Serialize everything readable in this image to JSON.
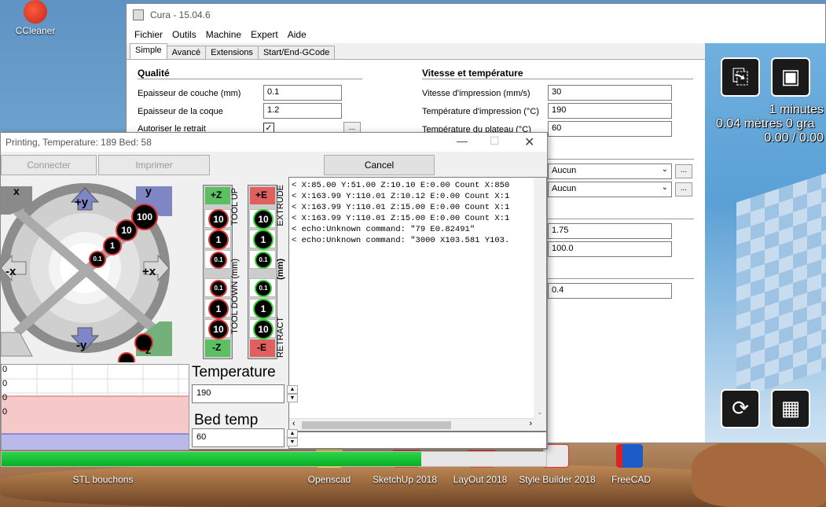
{
  "desktop": {
    "icons": [
      {
        "name": "ccleaner",
        "label": "CCleaner"
      },
      {
        "name": "stl-bouchons",
        "label": "STL bouchons"
      },
      {
        "name": "openscad",
        "label": "Openscad"
      },
      {
        "name": "sketchup",
        "label": "SketchUp 2018"
      },
      {
        "name": "layout",
        "label": "LayOut 2018"
      },
      {
        "name": "style-builder",
        "label": "Style Builder 2018"
      },
      {
        "name": "freecad",
        "label": "FreeCAD"
      }
    ]
  },
  "cura": {
    "title": "Cura - 15.04.6",
    "menu": [
      "Fichier",
      "Outils",
      "Machine",
      "Expert",
      "Aide"
    ],
    "tabs": [
      "Simple",
      "Avancé",
      "Extensions",
      "Start/End-GCode"
    ],
    "quality": {
      "title": "Qualité",
      "layer_height_label": "Epaisseur de couche (mm)",
      "layer_height": "0.1",
      "shell_label": "Epaisseur de la coque",
      "shell": "1.2",
      "retraction_label": "Autoriser le retrait",
      "retraction_checked": "✓",
      "dots": "..."
    },
    "speed": {
      "title": "Vitesse et température",
      "print_speed_label": "Vitesse d'impression (mm/s)",
      "print_speed": "30",
      "print_temp_label": "Température d'impression (°C)",
      "print_temp": "190",
      "bed_temp_label": "Température du plateau (°C)",
      "bed_temp": "60"
    },
    "support_type": "Aucun",
    "adhesion_type": "Aucun",
    "dots": "...",
    "diameter": "1.75",
    "flow": "100.0",
    "nozzle": "0.4",
    "viewport": {
      "time": "1 minutes",
      "material": "0.04 mètres 0 gra",
      "cost": "0.00 / 0.00"
    }
  },
  "printing": {
    "title": "Printing, Temperature: 189 Bed: 58",
    "connect_label": "Connecter",
    "print_label": "Imprimer",
    "cancel_label": "Cancel",
    "console_lines": [
      "< X:85.00 Y:51.00 Z:10.10 E:0.00 Count X:850",
      "< X:163.99 Y:110.01 Z:10.12 E:0.00 Count X:1",
      "< X:163.99 Y:110.01 Z:15.00 E:0.00 Count X:1",
      "< X:163.99 Y:110.01 Z:15.00 E:0.00 Count X:1",
      "< echo:Unknown command: \"79 E0.82491\"",
      "< echo:Unknown command: \"3000 X103.581 Y103."
    ],
    "temperature_label": "Temperature",
    "temperature_value": "190",
    "bed_temp_label": "Bed temp",
    "bed_temp_value": "60",
    "progress_fraction": 0.77,
    "jog": {
      "plus_y": "+y",
      "minus_y": "-y",
      "plus_x": "+x",
      "minus_x": "-x",
      "home_x": "x",
      "home_y": "y",
      "home_z": "z",
      "steps": [
        "100",
        "10",
        "1",
        "0.1"
      ]
    },
    "z_axis": {
      "up": "+Z",
      "down": "-Z",
      "steps_up": [
        "10",
        "1",
        "0.1"
      ],
      "steps_down": [
        "0.1",
        "1",
        "10"
      ],
      "tool_up": "TOOL UP",
      "tool_down": "TOOL DOWN (mm)"
    },
    "e_axis": {
      "up": "+E",
      "down": "-E",
      "steps_up": [
        "10",
        "1",
        "0.1"
      ],
      "steps_down": [
        "0.1",
        "1",
        "10"
      ],
      "extrude": "EXTRUDE",
      "retract": "RETRACT",
      "unit": "(mm)"
    },
    "graph_ticks": [
      "0",
      "0",
      "0",
      "0"
    ]
  }
}
